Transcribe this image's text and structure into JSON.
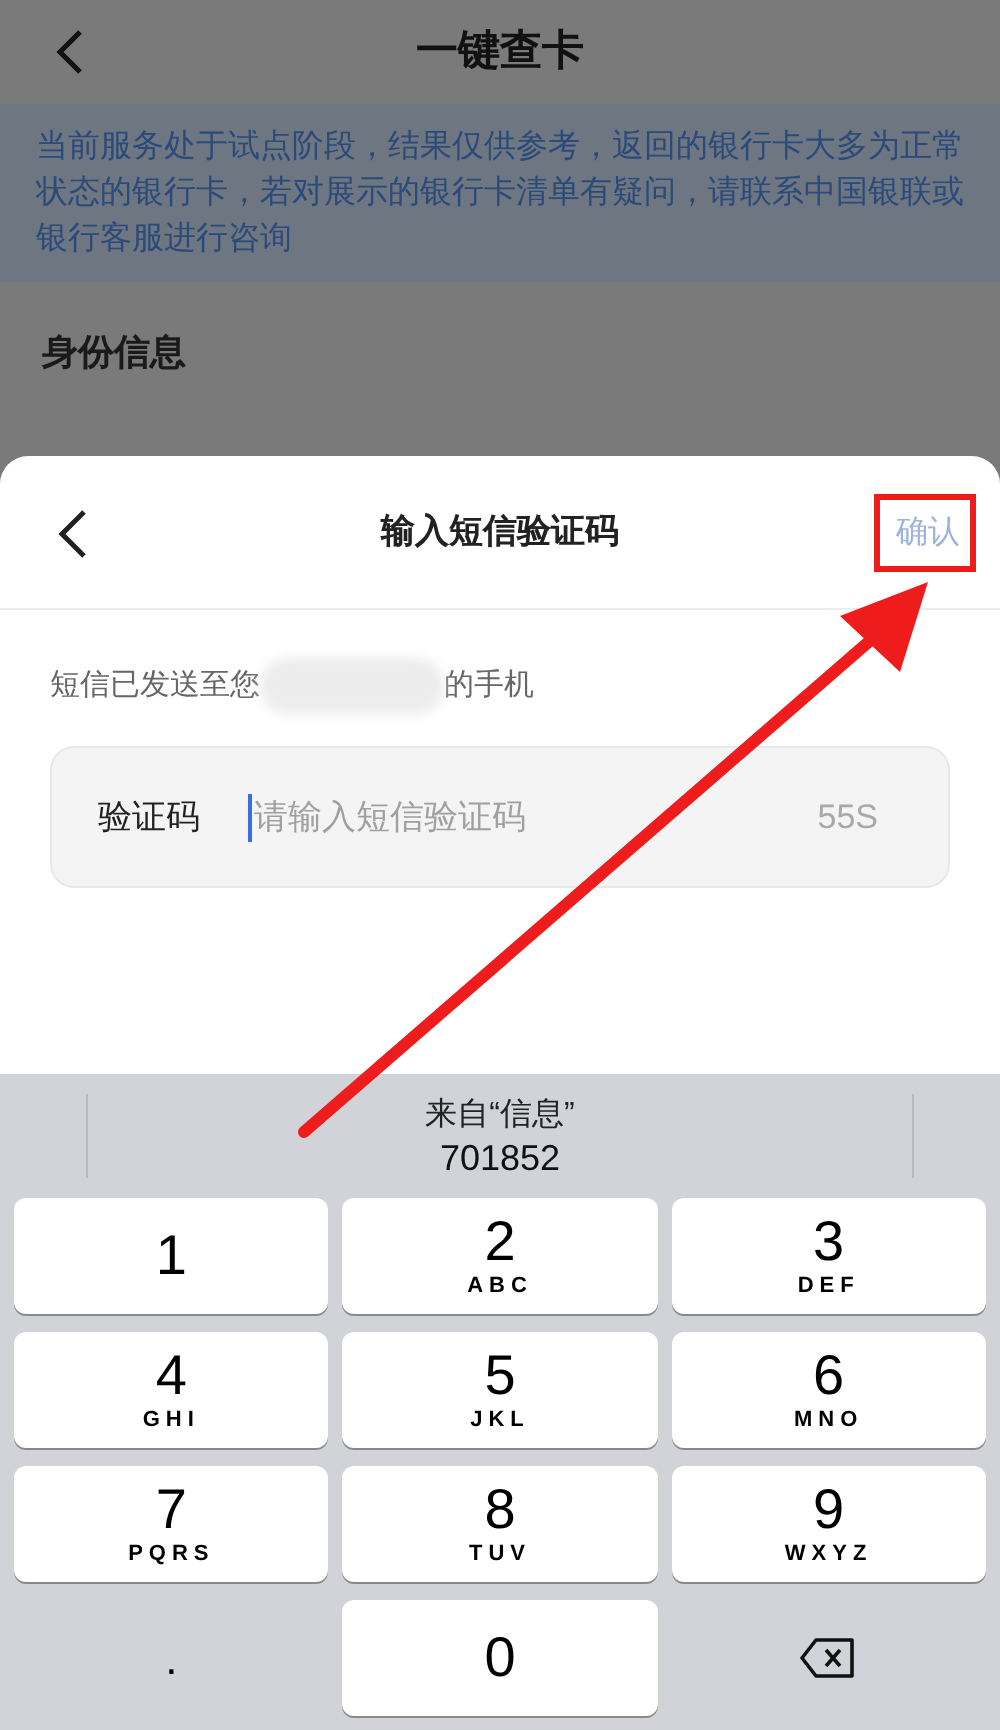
{
  "page": {
    "title": "一键查卡",
    "notice": "当前服务处于试点阶段，结果仅供参考，返回的银行卡大多为正常状态的银行卡，若对展示的银行卡清单有疑问，请联系中国银联或银行客服进行咨询",
    "section_title": "身份信息"
  },
  "sheet": {
    "title": "输入短信验证码",
    "confirm": {
      "label": "确认",
      "disabled": true
    },
    "sent_prefix": "短信已发送至您",
    "sent_suffix": "的手机",
    "field": {
      "label": "验证码",
      "placeholder": "请输入短信验证码",
      "countdown": "55S",
      "focused": true
    }
  },
  "annotation": {
    "highlight": true,
    "arrow": true
  },
  "keyboard": {
    "suggestion": {
      "source": "来自“信息”",
      "code": "701852"
    },
    "keys": [
      {
        "kind": "digit",
        "digit": "1"
      },
      {
        "kind": "digit",
        "digit": "2",
        "letters": "ABC"
      },
      {
        "kind": "digit",
        "digit": "3",
        "letters": "DEF"
      },
      {
        "kind": "digit",
        "digit": "4",
        "letters": "GHI"
      },
      {
        "kind": "digit",
        "digit": "5",
        "letters": "JKL"
      },
      {
        "kind": "digit",
        "digit": "6",
        "letters": "MNO"
      },
      {
        "kind": "digit",
        "digit": "7",
        "letters": "PQRS"
      },
      {
        "kind": "digit",
        "digit": "8",
        "letters": "TUV"
      },
      {
        "kind": "digit",
        "digit": "9",
        "letters": "WXYZ"
      },
      {
        "kind": "symbol",
        "digit": "."
      },
      {
        "kind": "digit",
        "digit": "0"
      },
      {
        "kind": "delete"
      }
    ]
  }
}
